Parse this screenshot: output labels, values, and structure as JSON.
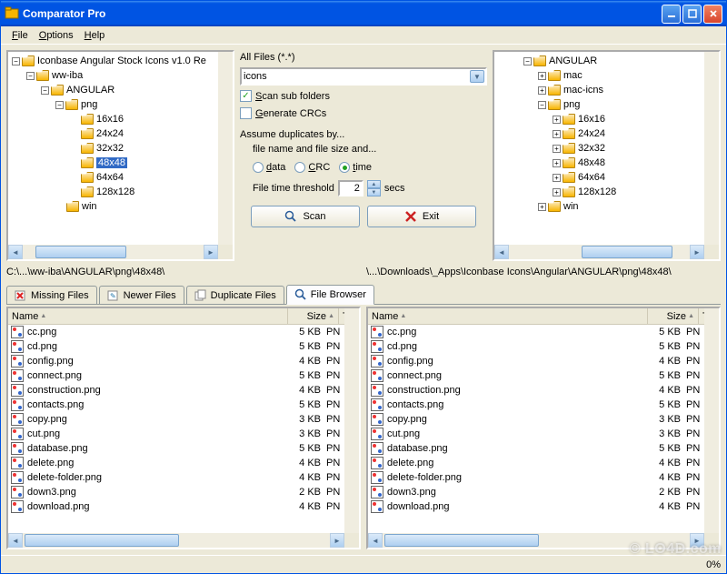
{
  "window": {
    "title": "Comparator Pro"
  },
  "menu": {
    "file": "File",
    "options": "Options",
    "help": "Help"
  },
  "leftTree": {
    "root": "Iconbase Angular Stock Icons v1.0 Re",
    "n1": "ww-iba",
    "n2": "ANGULAR",
    "n3": "png",
    "sizes": [
      "16x16",
      "24x24",
      "32x32",
      "48x48",
      "64x64",
      "128x128"
    ],
    "n4": "win",
    "selected": "48x48"
  },
  "rightTree": {
    "root": "ANGULAR",
    "c1": "mac",
    "c2": "mac-icns",
    "c3": "png",
    "sizes": [
      "16x16",
      "24x24",
      "32x32",
      "48x48",
      "64x64",
      "128x128"
    ],
    "c4": "win"
  },
  "middle": {
    "allFilesLabel": "All Files (*.*)",
    "comboValue": "icons",
    "scanSub": "Scan sub folders",
    "genCrc": "Generate CRCs",
    "assumeLabel": "Assume duplicates by...",
    "assumeSub": "file name and file size and...",
    "radioData": "data",
    "radioCrc": "CRC",
    "radioTime": "time",
    "thresholdLabel": "File time threshold",
    "thresholdValue": "2",
    "thresholdUnit": "secs",
    "scanBtn": "Scan",
    "exitBtn": "Exit",
    "scanSubChecked": true,
    "genCrcChecked": false,
    "radioSelected": "time"
  },
  "paths": {
    "left": "C:\\...\\ww-iba\\ANGULAR\\png\\48x48\\",
    "right": "\\...\\Downloads\\_Apps\\Iconbase Icons\\Angular\\ANGULAR\\png\\48x48\\"
  },
  "tabs": {
    "missing": "Missing Files",
    "newer": "Newer Files",
    "duplicate": "Duplicate Files",
    "browser": "File Browser"
  },
  "listHeaders": {
    "name": "Name",
    "size": "Size",
    "type": "Ty"
  },
  "files": [
    {
      "name": "cc.png",
      "size": "5 KB",
      "type": "PN"
    },
    {
      "name": "cd.png",
      "size": "5 KB",
      "type": "PN"
    },
    {
      "name": "config.png",
      "size": "4 KB",
      "type": "PN"
    },
    {
      "name": "connect.png",
      "size": "5 KB",
      "type": "PN"
    },
    {
      "name": "construction.png",
      "size": "4 KB",
      "type": "PN"
    },
    {
      "name": "contacts.png",
      "size": "5 KB",
      "type": "PN"
    },
    {
      "name": "copy.png",
      "size": "3 KB",
      "type": "PN"
    },
    {
      "name": "cut.png",
      "size": "3 KB",
      "type": "PN"
    },
    {
      "name": "database.png",
      "size": "5 KB",
      "type": "PN"
    },
    {
      "name": "delete.png",
      "size": "4 KB",
      "type": "PN"
    },
    {
      "name": "delete-folder.png",
      "size": "4 KB",
      "type": "PN"
    },
    {
      "name": "down3.png",
      "size": "2 KB",
      "type": "PN"
    },
    {
      "name": "download.png",
      "size": "4 KB",
      "type": "PN"
    }
  ],
  "status": {
    "percent": "0%"
  },
  "watermark": "© LO4D.com"
}
